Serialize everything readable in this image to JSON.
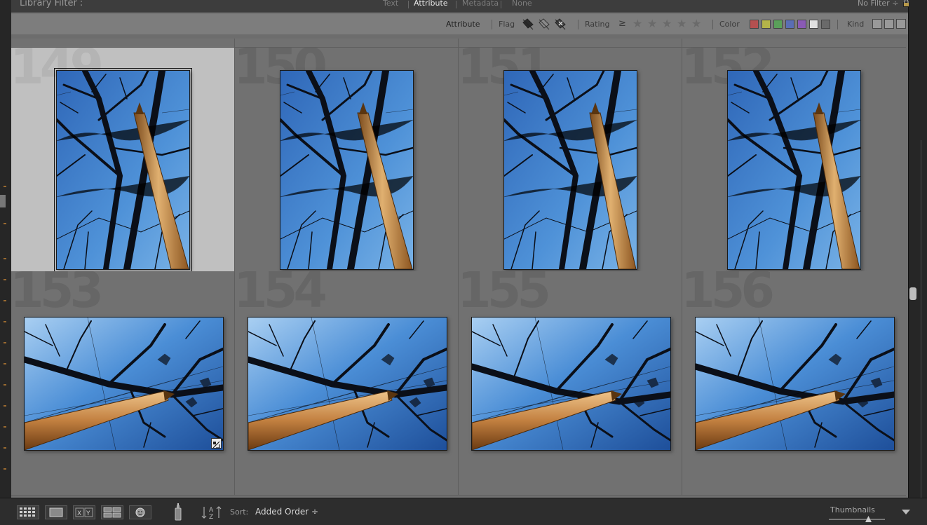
{
  "filter_bar": {
    "title": "Library Filter :",
    "tabs": [
      {
        "label": "Text",
        "active": false
      },
      {
        "label": "Attribute",
        "active": true
      },
      {
        "label": "Metadata",
        "active": false
      },
      {
        "label": "None",
        "active": false
      }
    ],
    "preset": "No Filter ÷"
  },
  "attribute_bar": {
    "heading": "Attribute",
    "flag_label": "Flag",
    "rating_label": "Rating",
    "rating_op": "≥",
    "rating_stars": 5,
    "color_label": "Color",
    "colors": [
      "#b45050",
      "#b4b44a",
      "#5aa05a",
      "#5a6eb4",
      "#8a5ab4",
      "#e0e0e0",
      "#6a6a6a"
    ],
    "kind_label": "Kind"
  },
  "grid": {
    "cells": [
      {
        "number": "149",
        "orientation": "portrait",
        "variant": "a",
        "selected": true,
        "edited": false
      },
      {
        "number": "150",
        "orientation": "portrait",
        "variant": "a",
        "selected": false,
        "edited": false
      },
      {
        "number": "151",
        "orientation": "portrait",
        "variant": "b",
        "selected": false,
        "edited": false
      },
      {
        "number": "152",
        "orientation": "portrait",
        "variant": "b",
        "selected": false,
        "edited": false
      },
      {
        "number": "153",
        "orientation": "landscape",
        "variant": "a",
        "selected": false,
        "edited": true
      },
      {
        "number": "154",
        "orientation": "landscape",
        "variant": "a",
        "selected": false,
        "edited": false
      },
      {
        "number": "155",
        "orientation": "landscape",
        "variant": "b",
        "selected": false,
        "edited": false
      },
      {
        "number": "156",
        "orientation": "landscape",
        "variant": "b",
        "selected": false,
        "edited": false
      }
    ]
  },
  "toolbar": {
    "sort_label": "Sort:",
    "sort_value": "Added Order ÷",
    "thumbnails_label": "Thumbnails",
    "thumbnail_size": 0.7,
    "view_buttons": [
      "grid-view-icon",
      "loupe-view-icon",
      "compare-view-icon",
      "survey-view-icon",
      "people-view-icon"
    ]
  }
}
